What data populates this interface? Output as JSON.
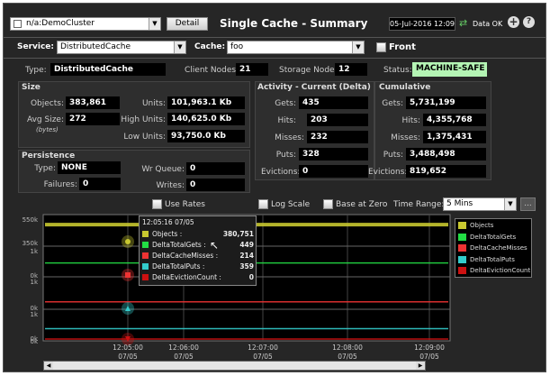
{
  "header": {
    "cluster_select": "n/a:DemoCluster",
    "detail_button": "Detail",
    "title": "Single Cache - Summary",
    "datetime": "05-Jul-2016 12:09",
    "data_status": "Data OK"
  },
  "filters": {
    "service_label": "Service:",
    "service_value": "DistributedCache",
    "cache_label": "Cache:",
    "cache_value": "foo",
    "front_label": "Front"
  },
  "info": {
    "type_label": "Type:",
    "type_value": "DistributedCache",
    "client_nodes_label": "Client Nodes:",
    "client_nodes_value": "21",
    "storage_nodes_label": "Storage Nodes:",
    "storage_nodes_value": "12",
    "status_label": "Status:",
    "status_value": "MACHINE-SAFE",
    "status_color": "#b5f5b5"
  },
  "size": {
    "title": "Size",
    "objects_label": "Objects:",
    "objects_value": "383,861",
    "avg_size_label": "Avg Size:",
    "avg_size_value": "272",
    "avg_size_unit": "(bytes)",
    "units_label": "Units:",
    "units_value": "101,963.1 Kb",
    "high_units_label": "High Units:",
    "high_units_value": "140,625.0 Kb",
    "low_units_label": "Low Units:",
    "low_units_value": "93,750.0 Kb"
  },
  "activity": {
    "title": "Activity - Current (Delta)",
    "gets_label": "Gets:",
    "gets_value": "435",
    "hits_label": "Hits:",
    "hits_value": "203",
    "misses_label": "Misses:",
    "misses_value": "232",
    "puts_label": "Puts:",
    "puts_value": "328",
    "evictions_label": "Evictions:",
    "evictions_value": "0"
  },
  "cumulative": {
    "title": "Cumulative",
    "gets_label": "Gets:",
    "gets_value": "5,731,199",
    "hits_label": "Hits:",
    "hits_value": "4,355,768",
    "misses_label": "Misses:",
    "misses_value": "1,375,431",
    "puts_label": "Puts:",
    "puts_value": "3,488,498",
    "evictions_label": "Evictions:",
    "evictions_value": "819,652"
  },
  "persistence": {
    "title": "Persistence",
    "type_label": "Type:",
    "type_value": "NONE",
    "wr_queue_label": "Wr Queue:",
    "wr_queue_value": "0",
    "failures_label": "Failures:",
    "failures_value": "0",
    "writes_label": "Writes:",
    "writes_value": "0"
  },
  "controls": {
    "use_rates": "Use Rates",
    "log_scale": "Log Scale",
    "base_at_zero": "Base at Zero",
    "time_range_label": "Time Range:",
    "time_range_value": "5 Mins",
    "more_button": "..."
  },
  "tooltip": {
    "time": "12:05:16 07/05",
    "rows": [
      {
        "name": "Objects :",
        "value": "380,751",
        "color": "#c8c830"
      },
      {
        "name": "DeltaTotalGets :",
        "value": "449",
        "color": "#22dd44"
      },
      {
        "name": "DeltaCacheMisses :",
        "value": "214",
        "color": "#ee3333"
      },
      {
        "name": "DeltaTotalPuts :",
        "value": "359",
        "color": "#33cccc"
      },
      {
        "name": "DeltaEvictionCount :",
        "value": "0",
        "color": "#cc1111"
      }
    ]
  },
  "chart_data": {
    "type": "line",
    "legend_position": "right",
    "series": [
      {
        "name": "Objects",
        "color": "#c8c830",
        "y_ticks": [
          "550k",
          "350k"
        ],
        "ylim": [
          0,
          550000
        ],
        "values": [
          380751,
          380751,
          380751,
          380751,
          380751
        ]
      },
      {
        "name": "DeltaTotalGets",
        "color": "#22dd44",
        "y_ticks": [
          "1k",
          "0k"
        ],
        "ylim": [
          0,
          1000
        ],
        "values": [
          449,
          449,
          449,
          449,
          449
        ]
      },
      {
        "name": "DeltaCacheMisses",
        "color": "#ee3333",
        "y_ticks": [
          "1k",
          "0k"
        ],
        "ylim": [
          0,
          1000
        ],
        "values": [
          214,
          214,
          214,
          214,
          214
        ]
      },
      {
        "name": "DeltaTotalPuts",
        "color": "#33cccc",
        "y_ticks": [
          "1k",
          "0k"
        ],
        "ylim": [
          0,
          1000
        ],
        "values": [
          359,
          359,
          359,
          359,
          359
        ]
      },
      {
        "name": "DeltaEvictionCount",
        "color": "#cc1111",
        "y_ticks": [
          "1k",
          "0k"
        ],
        "ylim": [
          0,
          1000
        ],
        "values": [
          0,
          0,
          0,
          0,
          0
        ]
      }
    ],
    "x_ticks": [
      {
        "time": "12:05:00",
        "date": "07/05"
      },
      {
        "time": "12:06:00",
        "date": "07/05"
      },
      {
        "time": "12:07:00",
        "date": "07/05"
      },
      {
        "time": "12:08:00",
        "date": "07/05"
      },
      {
        "time": "12:09:00",
        "date": "07/05"
      }
    ],
    "grid": true
  }
}
